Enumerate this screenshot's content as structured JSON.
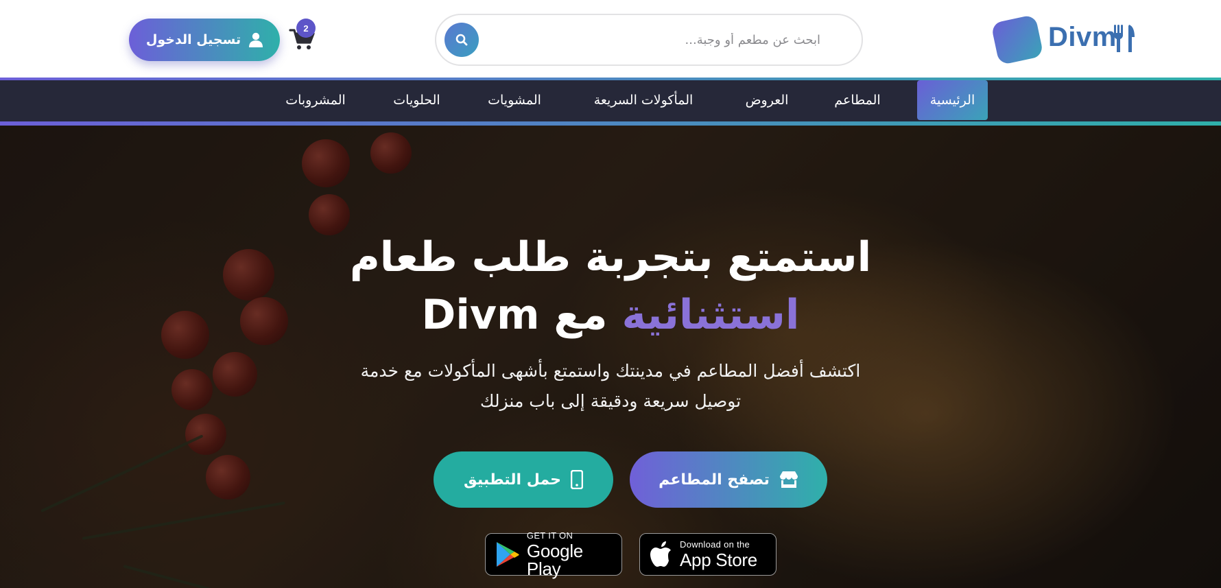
{
  "header": {
    "logo_text": "Divm",
    "search_placeholder": "ابحث عن مطعم أو وجبة...",
    "cart_count": "2",
    "login_label": "تسجيل الدخول"
  },
  "nav": {
    "items": [
      {
        "label": "الرئيسية",
        "active": true
      },
      {
        "label": "المطاعم"
      },
      {
        "label": "العروض"
      },
      {
        "label": "المأكولات السريعة"
      },
      {
        "label": "المشويات"
      },
      {
        "label": "الحلويات"
      },
      {
        "label": "المشروبات"
      }
    ]
  },
  "hero": {
    "title_line1": "استمتع بتجربة طلب طعام",
    "title_accent": "استثنائية",
    "title_line2_rest": "مع Divm",
    "subtitle_line1": "اكتشف أفضل المطاعم في مدينتك واستمتع بأشهى المأكولات مع خدمة",
    "subtitle_line2": "توصيل سريعة ودقيقة إلى باب منزلك",
    "browse_label": "تصفح المطاعم",
    "app_label": "حمل التطبيق"
  },
  "badges": {
    "apple_small": "Download on the",
    "apple_big": "App Store",
    "google_small": "GET IT ON",
    "google_big": "Google Play"
  },
  "colors": {
    "accent_purple": "#6c5fd8",
    "accent_teal": "#2fb0aa",
    "nav_bg": "#262839",
    "title_accent": "#8a72d8"
  },
  "icons": {
    "logo": "utensils-icon",
    "search": "search-icon",
    "cart": "cart-icon",
    "user": "user-icon",
    "store": "store-icon",
    "phone": "mobile-icon",
    "apple": "apple-icon",
    "google_play": "google-play-icon"
  }
}
